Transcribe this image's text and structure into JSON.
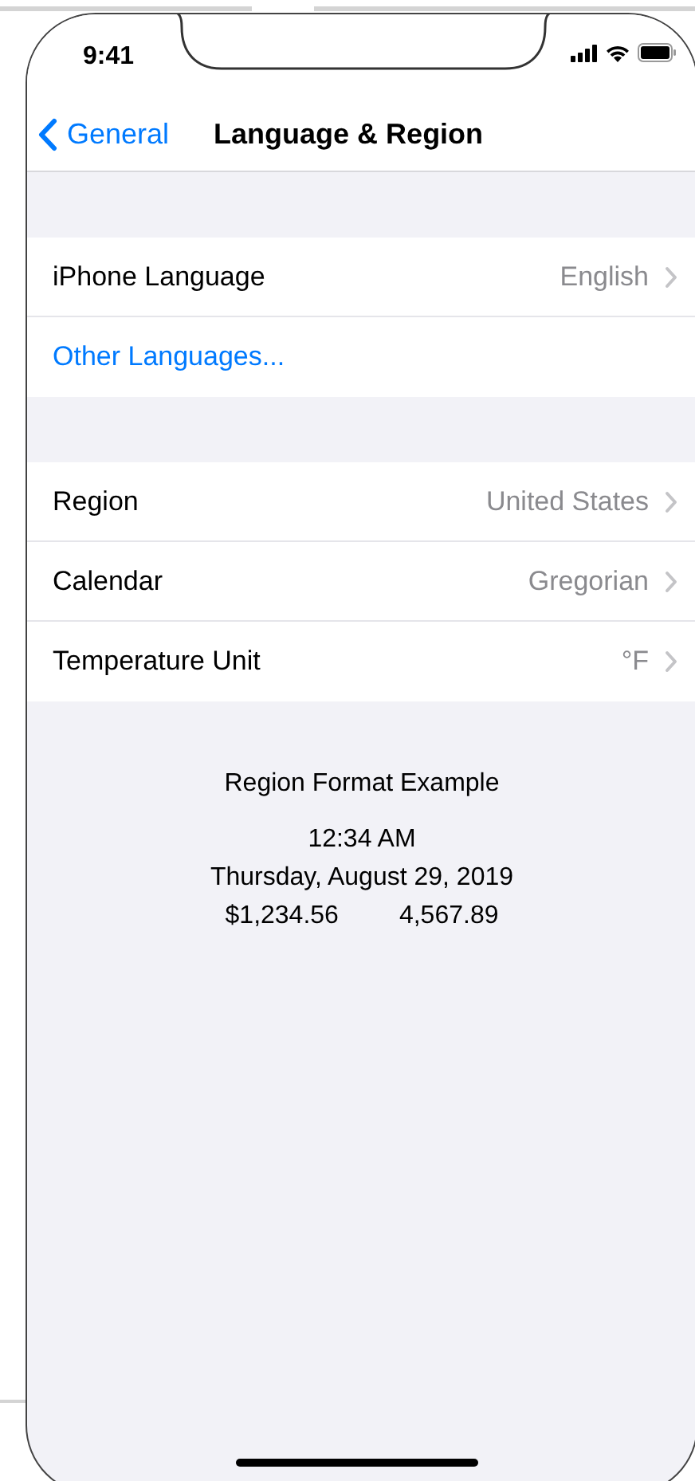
{
  "status_bar": {
    "time": "9:41"
  },
  "nav": {
    "back": "General",
    "title": "Language & Region"
  },
  "groups": [
    {
      "rows": [
        {
          "kind": "detail",
          "label": "iPhone Language",
          "value": "English"
        },
        {
          "kind": "link",
          "label": "Other Languages..."
        }
      ]
    },
    {
      "rows": [
        {
          "kind": "detail",
          "label": "Region",
          "value": "United States"
        },
        {
          "kind": "detail",
          "label": "Calendar",
          "value": "Gregorian"
        },
        {
          "kind": "detail",
          "label": "Temperature Unit",
          "value": "°F"
        }
      ]
    }
  ],
  "region_format": {
    "title": "Region Format Example",
    "time": "12:34 AM",
    "date": "Thursday, August 29, 2019",
    "currency": "$1,234.56",
    "number": "4,567.89"
  }
}
